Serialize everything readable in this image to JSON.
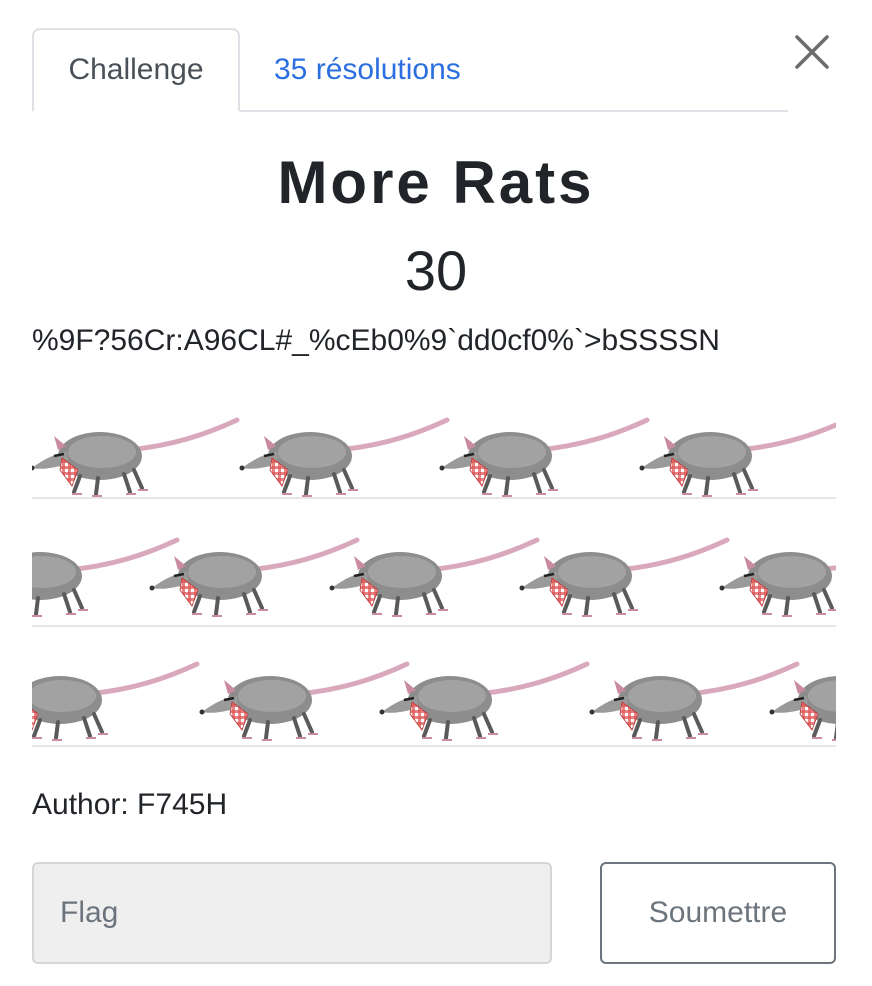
{
  "tabs": {
    "challenge_label": "Challenge",
    "solves_label": "35 résolutions"
  },
  "challenge": {
    "name": "More Rats",
    "value": "30",
    "description": "%9F?56Cr:A96CL#_%cEb0%9`dd0cf0%`>bSSSSN",
    "author": "Author: F745H"
  },
  "form": {
    "flag_placeholder": "Flag",
    "submit_label": "Soumettre"
  },
  "icons": {
    "close": "close-icon"
  }
}
